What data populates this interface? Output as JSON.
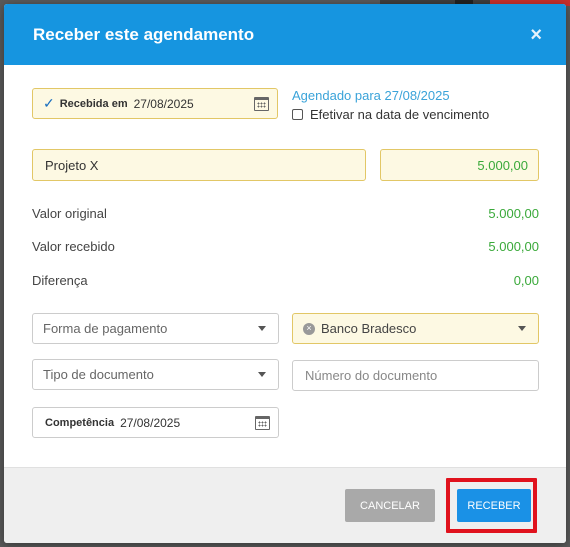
{
  "modal": {
    "title": "Receber este agendamento",
    "close_symbol": "×"
  },
  "received": {
    "check_symbol": "✓",
    "label": "Recebida em",
    "date": "27/08/2025"
  },
  "scheduled": {
    "text": "Agendado para 27/08/2025",
    "settle_label": "Efetivar na data de vencimento",
    "settle_checked": false
  },
  "project": {
    "value": "Projeto X"
  },
  "amount": {
    "value": "5.000,00"
  },
  "summary": [
    {
      "label": "Valor original",
      "value": "5.000,00"
    },
    {
      "label": "Valor recebido",
      "value": "5.000,00"
    },
    {
      "label": "Diferença",
      "value": "0,00"
    }
  ],
  "payment_method": {
    "placeholder": "Forma de pagamento"
  },
  "bank": {
    "value": "Banco Bradesco",
    "clear_symbol": "×"
  },
  "document_type": {
    "placeholder": "Tipo de documento"
  },
  "document_number": {
    "placeholder": "Número do documento"
  },
  "competence": {
    "label": "Competência",
    "date": "27/08/2025"
  },
  "footer": {
    "cancel_label": "CANCELAR",
    "receive_label": "RECEBER"
  },
  "colors": {
    "header": "#1695e0",
    "amount_green": "#3aa93a",
    "highlight_red": "#e0121d",
    "field_yellow": "#fdf9e3"
  }
}
